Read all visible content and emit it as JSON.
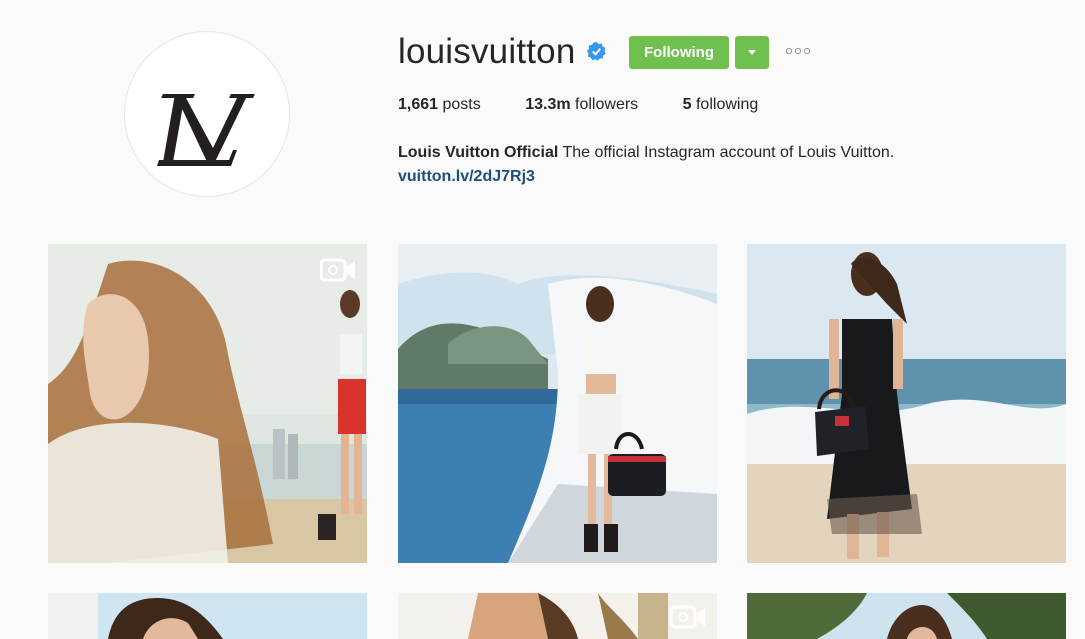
{
  "profile": {
    "username": "louisvuitton",
    "verified": true,
    "follow_button": "Following",
    "posts_count": "1,661",
    "posts_label": "posts",
    "followers_count": "13.3m",
    "followers_label": "followers",
    "following_count": "5",
    "following_label": "following",
    "bio_name": "Louis Vuitton Official",
    "bio_text": "The official Instagram account of Louis Vuitton.",
    "bio_link": "vuitton.lv/2dJ7Rj3"
  },
  "avatar_text": "LV",
  "colors": {
    "follow_green": "#70c050",
    "verified_blue": "#3897f0",
    "link_blue": "#1f4e79"
  },
  "icons": [
    "verified-badge-icon",
    "chevron-down-icon",
    "more-options-icon",
    "video-icon"
  ],
  "posts": [
    {
      "type": "video",
      "subject": "woman profile beach collage"
    },
    {
      "type": "photo",
      "subject": "woman with handbag by pool"
    },
    {
      "type": "photo",
      "subject": "woman in black dress on beach"
    },
    {
      "type": "photo",
      "subject": "woman portrait"
    },
    {
      "type": "video",
      "subject": "woman with palm trees"
    },
    {
      "type": "photo",
      "subject": "woman under palm trees"
    }
  ]
}
